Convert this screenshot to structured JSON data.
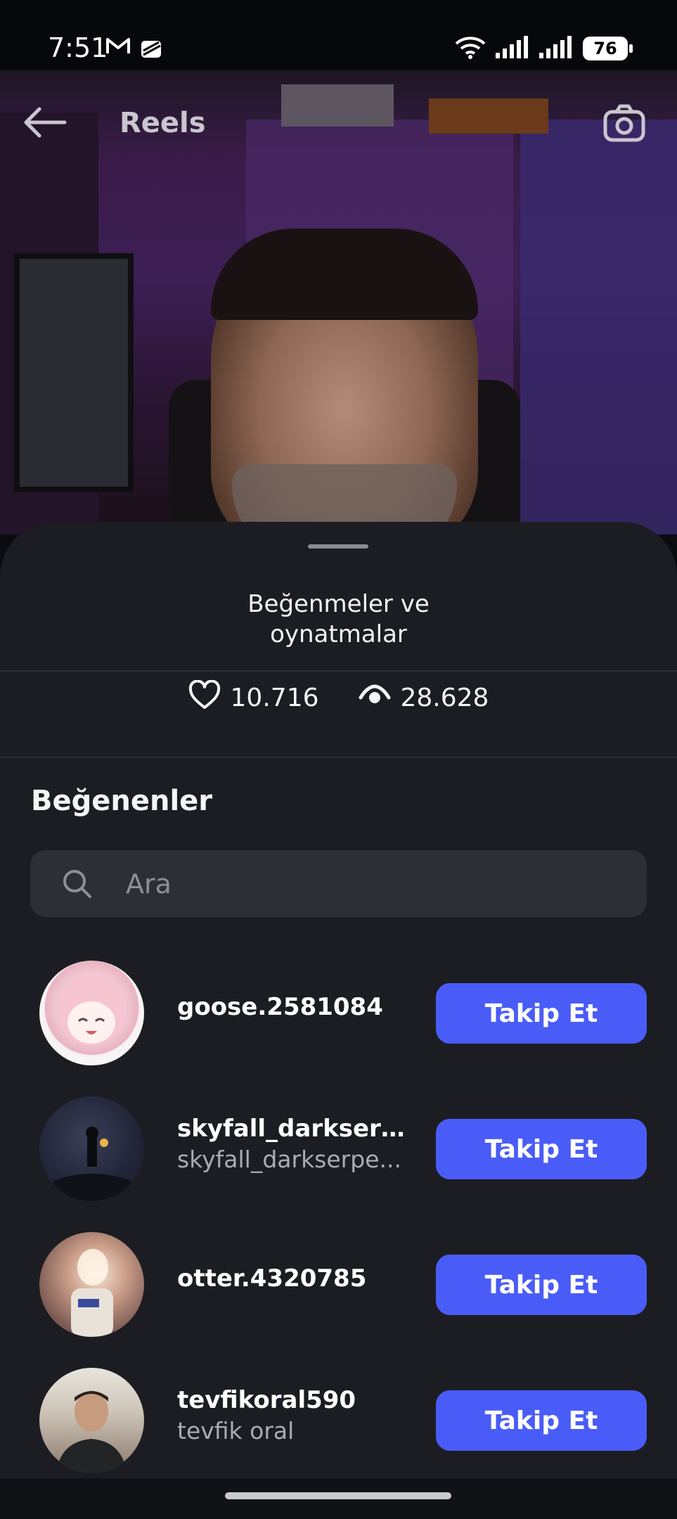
{
  "status_bar": {
    "time": "7:51",
    "battery": "76"
  },
  "header": {
    "title": "Reels"
  },
  "sheet": {
    "title_line1": "Beğenmeler ve",
    "title_line2": "oynatmalar",
    "likes_count": "10.716",
    "plays_count": "28.628",
    "section_title": "Beğenenler",
    "search_placeholder": "Ara"
  },
  "users": [
    {
      "username": "goose.2581084",
      "fullname": "",
      "button": "Takip Et"
    },
    {
      "username": "skyfall_darkserp...",
      "fullname": "skyfall_darkserpe...",
      "button": "Takip Et"
    },
    {
      "username": "otter.4320785",
      "fullname": "",
      "button": "Takip Et"
    },
    {
      "username": "tevfikoral590",
      "fullname": "tevfik oral",
      "button": "Takip Et"
    }
  ],
  "colors": {
    "accent": "#4a5cf7",
    "sheet_bg": "#1c1d22",
    "search_bg": "#2c3035"
  }
}
